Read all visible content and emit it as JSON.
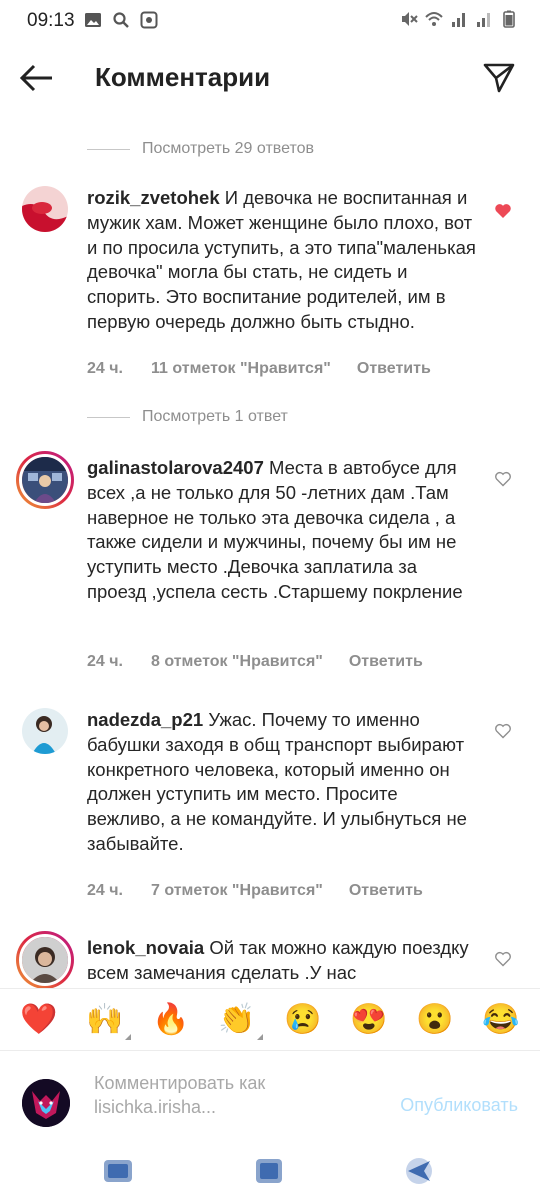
{
  "status_bar": {
    "time": "09:13"
  },
  "header": {
    "title": "Комментарии"
  },
  "view_replies": [
    {
      "text": "Посмотреть 29 ответов"
    },
    {
      "text": "Посмотреть 1 ответ"
    }
  ],
  "comments": [
    {
      "username": "rozik_zvetohek",
      "text": "И девочка не воспитанная и мужик хам. Может женщине было плохо, вот и по просила уступить, а это типа\"маленькая девочка\" могла бы стать, не сидеть и спорить. Это воспитание родителей, им в первую очередь должно быть стыдно.",
      "time": "24 ч.",
      "likes": "11 отметок \"Нравится\"",
      "reply": "Ответить",
      "liked": true
    },
    {
      "username": "galinastolarova2407",
      "text": "Места в автобусе для всех ,а не только для 50 -летних дам .Там наверное не только эта девочка сидела , а также сидели и мужчины, почему бы им не уступить место .Девочка заплатила за проезд ,успела сесть .Старшему покрление",
      "time": "24 ч.",
      "likes": "8 отметок \"Нравится\"",
      "reply": "Ответить",
      "liked": false
    },
    {
      "username": "nadezda_p21",
      "text": "Ужас. Почему то именно бабушки заходя в общ транспорт выбирают конкретного человека, который именно он должен уступить им место. Просите вежливо, а не командуйте.  И улыбнуться не забывайте.",
      "time": "24 ч.",
      "likes": "7 отметок \"Нравится\"",
      "reply": "Ответить",
      "liked": false
    },
    {
      "username": "lenok_novaia",
      "text": "Ой так можно каждую поездку всем замечания сделать .У нас",
      "liked": false
    }
  ],
  "emojis": [
    "❤️",
    "🙌",
    "🔥",
    "👏",
    "😢",
    "😍",
    "😮",
    "😂"
  ],
  "composer": {
    "placeholder": "Комментировать как lisichka.irisha...",
    "publish_label": "Опубликовать"
  },
  "colors": {
    "like_red": "#ed4956",
    "secondary_text": "#8e8e8e",
    "publish_disabled": "#b2dffc"
  }
}
